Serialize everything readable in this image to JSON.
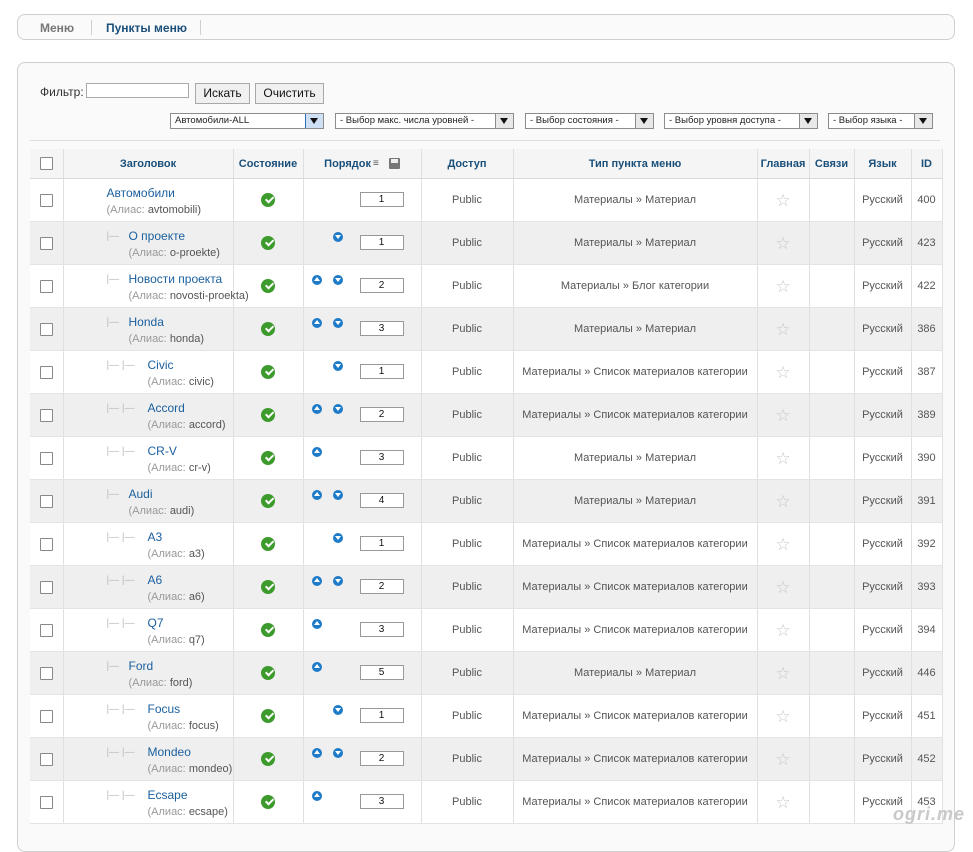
{
  "submenu": {
    "tab_menus": "Меню",
    "tab_items": "Пункты меню"
  },
  "filter": {
    "label": "Фильтр:",
    "value": "",
    "search_btn": "Искать",
    "clear_btn": "Очистить",
    "selects": {
      "menu": "Автомобили-ALL",
      "levels": "- Выбор макс. числа уровней -",
      "state": "- Выбор состояния -",
      "access": "- Выбор уровня доступа -",
      "language": "- Выбор языка -"
    }
  },
  "columns": {
    "title": "Заголовок",
    "state": "Состояние",
    "order": "Порядок",
    "access": "Доступ",
    "type": "Тип пункта меню",
    "home": "Главная",
    "assoc": "Связи",
    "language": "Язык",
    "id": "ID"
  },
  "rows": [
    {
      "title": "Автомобили",
      "alias_label": "(Алиас:",
      "alias": "avtomobili)",
      "level": 0,
      "order": "1",
      "up": false,
      "down": false,
      "access": "Public",
      "type": "Материалы » Материал",
      "language": "Русский",
      "id": "400"
    },
    {
      "title": "О проекте",
      "alias_label": "(Алиас:",
      "alias": "o-proekte)",
      "level": 1,
      "order": "1",
      "up": false,
      "down": true,
      "access": "Public",
      "type": "Материалы » Материал",
      "language": "Русский",
      "id": "423"
    },
    {
      "title": "Новости проекта",
      "alias_label": "(Алиас:",
      "alias": "novosti-proekta)",
      "level": 1,
      "order": "2",
      "up": true,
      "down": true,
      "access": "Public",
      "type": "Материалы » Блог категории",
      "language": "Русский",
      "id": "422"
    },
    {
      "title": "Honda",
      "alias_label": "(Алиас:",
      "alias": "honda)",
      "level": 1,
      "order": "3",
      "up": true,
      "down": true,
      "access": "Public",
      "type": "Материалы » Материал",
      "language": "Русский",
      "id": "386"
    },
    {
      "title": "Civic",
      "alias_label": "(Алиас:",
      "alias": "civic)",
      "level": 2,
      "order": "1",
      "up": false,
      "down": true,
      "access": "Public",
      "type": "Материалы » Список материалов категории",
      "language": "Русский",
      "id": "387"
    },
    {
      "title": "Accord",
      "alias_label": "(Алиас:",
      "alias": "accord)",
      "level": 2,
      "order": "2",
      "up": true,
      "down": true,
      "access": "Public",
      "type": "Материалы » Список материалов категории",
      "language": "Русский",
      "id": "389"
    },
    {
      "title": "CR-V",
      "alias_label": "(Алиас:",
      "alias": "cr-v)",
      "level": 2,
      "order": "3",
      "up": true,
      "down": false,
      "access": "Public",
      "type": "Материалы » Материал",
      "language": "Русский",
      "id": "390"
    },
    {
      "title": "Audi",
      "alias_label": "(Алиас:",
      "alias": "audi)",
      "level": 1,
      "order": "4",
      "up": true,
      "down": true,
      "access": "Public",
      "type": "Материалы » Материал",
      "language": "Русский",
      "id": "391"
    },
    {
      "title": "A3",
      "alias_label": "(Алиас:",
      "alias": "a3)",
      "level": 2,
      "order": "1",
      "up": false,
      "down": true,
      "access": "Public",
      "type": "Материалы » Список материалов категории",
      "language": "Русский",
      "id": "392"
    },
    {
      "title": "A6",
      "alias_label": "(Алиас:",
      "alias": "a6)",
      "level": 2,
      "order": "2",
      "up": true,
      "down": true,
      "access": "Public",
      "type": "Материалы » Список материалов категории",
      "language": "Русский",
      "id": "393"
    },
    {
      "title": "Q7",
      "alias_label": "(Алиас:",
      "alias": "q7)",
      "level": 2,
      "order": "3",
      "up": true,
      "down": false,
      "access": "Public",
      "type": "Материалы » Список материалов категории",
      "language": "Русский",
      "id": "394"
    },
    {
      "title": "Ford",
      "alias_label": "(Алиас:",
      "alias": "ford)",
      "level": 1,
      "order": "5",
      "up": true,
      "down": false,
      "access": "Public",
      "type": "Материалы » Материал",
      "language": "Русский",
      "id": "446"
    },
    {
      "title": "Focus",
      "alias_label": "(Алиас:",
      "alias": "focus)",
      "level": 2,
      "order": "1",
      "up": false,
      "down": true,
      "access": "Public",
      "type": "Материалы » Список материалов категории",
      "language": "Русский",
      "id": "451"
    },
    {
      "title": "Mondeo",
      "alias_label": "(Алиас:",
      "alias": "mondeo)",
      "level": 2,
      "order": "2",
      "up": true,
      "down": true,
      "access": "Public",
      "type": "Материалы » Список материалов категории",
      "language": "Русский",
      "id": "452"
    },
    {
      "title": "Ecsape",
      "alias_label": "(Алиас:",
      "alias": "ecsape)",
      "level": 2,
      "order": "3",
      "up": true,
      "down": false,
      "access": "Public",
      "type": "Материалы » Список материалов категории",
      "language": "Русский",
      "id": "453"
    }
  ],
  "watermark": "ogri.me",
  "icons": {
    "state": "published-check-icon",
    "home": "star-icon",
    "order_up": "arrow-up-icon",
    "order_down": "arrow-down-icon",
    "save_order": "save-icon",
    "sort": "sort-icon"
  }
}
